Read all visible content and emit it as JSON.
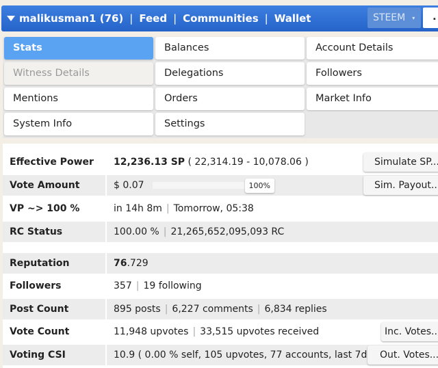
{
  "topbar": {
    "user": "malikusman1 (76)",
    "feed": "Feed",
    "communities": "Communities",
    "wallet": "Wallet",
    "coin": "STEEM",
    "coin_caret": "▾",
    "search": "."
  },
  "menu": [
    {
      "label": "Stats",
      "state": "active"
    },
    {
      "label": "Balances"
    },
    {
      "label": "Account Details"
    },
    {
      "label": "Witness Details",
      "state": "disabled"
    },
    {
      "label": "Delegations"
    },
    {
      "label": "Followers"
    },
    {
      "label": "Mentions"
    },
    {
      "label": "Orders"
    },
    {
      "label": "Market Info"
    },
    {
      "label": "System Info"
    },
    {
      "label": "Settings"
    }
  ],
  "stats": {
    "effective_power": {
      "label": "Effective Power",
      "value": "12,236.13 SP",
      "detail": "( 22,314.19 - 10,078.06 )",
      "button": "Simulate SP..."
    },
    "vote_amount": {
      "label": "Vote Amount",
      "value": "$ 0.07",
      "slider_percent": "100%",
      "button": "Sim. Payout..."
    },
    "vp": {
      "label": "VP ~> 100 %",
      "value": "in 14h 8m",
      "detail": "Tomorrow, 05:38"
    },
    "rc": {
      "label": "RC Status",
      "value": "100.00 %",
      "detail": "21,265,652,095,093 RC"
    },
    "reputation": {
      "label": "Reputation",
      "value": "76",
      "detail": ".729"
    },
    "followers": {
      "label": "Followers",
      "value": "357",
      "detail": "19 following"
    },
    "post_count": {
      "label": "Post Count",
      "value": "895 posts",
      "detail": "6,227 comments",
      "detail2": "6,834 replies"
    },
    "vote_count": {
      "label": "Vote Count",
      "value": "11,948 upvotes",
      "detail": "33,515 upvotes received",
      "button": "Inc. Votes..."
    },
    "voting_csi": {
      "label": "Voting CSI",
      "value": "10.9 ( 0.00 % self, 105 upvotes, 77 accounts, last 7d )",
      "button": "Out. Votes..."
    }
  }
}
